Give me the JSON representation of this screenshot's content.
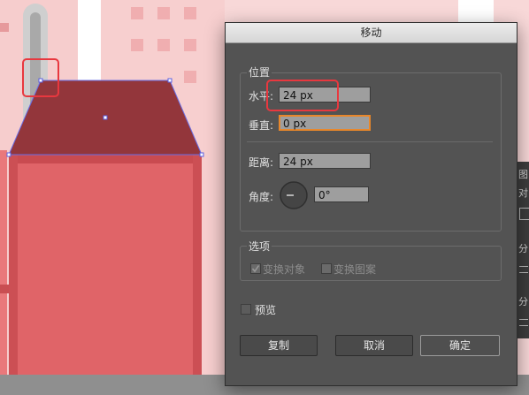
{
  "canvas": {
    "colors": {
      "bg": "#f6d0d0",
      "roof": "#93363b",
      "wall": "#e06468",
      "tube": "#cfcfcf"
    }
  },
  "dialog": {
    "title": "移动",
    "position_group": {
      "title": "位置",
      "horizontal_label": "水平:",
      "horizontal_value": "24 px",
      "vertical_label": "垂直:",
      "vertical_value": "0 px",
      "distance_label": "距离:",
      "distance_value": "24 px",
      "angle_label": "角度:",
      "angle_value": "0°"
    },
    "options_group": {
      "title": "选项",
      "transform_objects_label": "变换对象",
      "transform_objects_checked": true,
      "transform_patterns_label": "变换图案",
      "transform_patterns_checked": false
    },
    "preview_label": "预览",
    "preview_checked": false,
    "buttons": {
      "copy": "复制",
      "cancel": "取消",
      "ok": "确定"
    }
  },
  "side_panel": {
    "items": [
      "图",
      "对",
      "分",
      "分"
    ]
  }
}
